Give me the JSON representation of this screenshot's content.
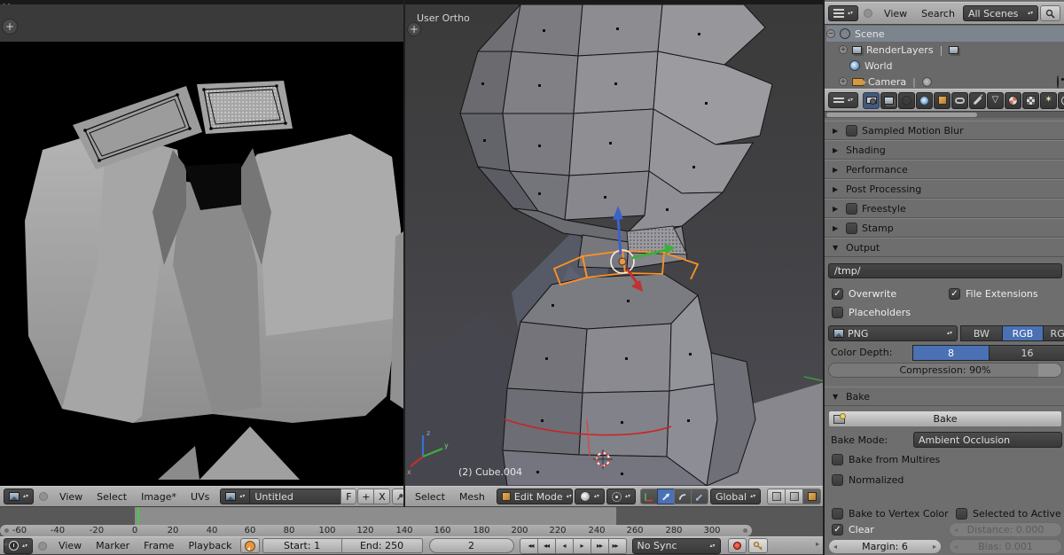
{
  "uv_editor": {
    "menus": {
      "view": "View",
      "select": "Select",
      "image": "Image*",
      "uvs": "UVs"
    },
    "image_name": "Untitled",
    "fake_user": "F",
    "new_image": "+",
    "unlink": "X"
  },
  "viewport": {
    "view_label": "User Ortho",
    "object_info": "(2) Cube.004",
    "menus": {
      "select": "Select",
      "mesh": "Mesh"
    },
    "mode": "Edit Mode",
    "orientation": "Global"
  },
  "outliner": {
    "menus": {
      "view": "View",
      "search": "Search"
    },
    "display_filter": "All Scenes",
    "items": {
      "scene": "Scene",
      "renderlayers": "RenderLayers",
      "world": "World",
      "camera": "Camera"
    }
  },
  "properties": {
    "panels": {
      "motion_blur": "Sampled Motion Blur",
      "shading": "Shading",
      "performance": "Performance",
      "post_processing": "Post Processing",
      "freestyle": "Freestyle",
      "stamp": "Stamp"
    },
    "output": {
      "title": "Output",
      "path": "/tmp/",
      "overwrite": "Overwrite",
      "file_extensions": "File Extensions",
      "placeholders": "Placeholders",
      "format": "PNG",
      "bw": "BW",
      "rgb": "RGB",
      "rgba": "RGBA",
      "color_depth_label": "Color Depth:",
      "depth8": "8",
      "depth16": "16",
      "compression": "Compression: 90%"
    },
    "bake": {
      "title": "Bake",
      "button": "Bake",
      "mode_label": "Bake Mode:",
      "mode": "Ambient Occlusion",
      "from_multires": "Bake from Multires",
      "normalized": "Normalized",
      "to_vertex": "Bake to Vertex Color",
      "selected_to_active": "Selected to Active",
      "clear": "Clear",
      "distance": "Distance: 0.000",
      "margin": "Margin: 6",
      "bias": "Bias: 0.001"
    }
  },
  "timeline": {
    "menus": {
      "view": "View",
      "marker": "Marker",
      "frame": "Frame",
      "playback": "Playback"
    },
    "start": "Start: 1",
    "end": "End: 250",
    "current_frame": "2",
    "sync": "No Sync",
    "ticks": [
      "-60",
      "-40",
      "-20",
      "0",
      "20",
      "40",
      "60",
      "80",
      "100",
      "120",
      "140",
      "160",
      "180",
      "200",
      "220",
      "240",
      "260",
      "280",
      "300"
    ]
  },
  "colors": {
    "accent_blue": "#4a71b4",
    "selection_orange": "#ff8c19",
    "current_frame_green": "#3fcf3f"
  }
}
